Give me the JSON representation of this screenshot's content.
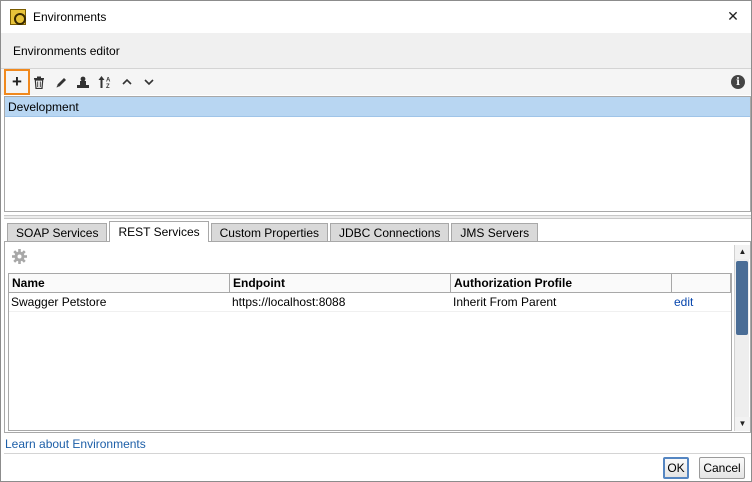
{
  "window": {
    "title": "Environments",
    "close_glyph": "✕"
  },
  "header": {
    "text": "Environments editor"
  },
  "toolbar": {
    "add_glyph": "+",
    "delete_glyph": "🗑",
    "edit_glyph": "✎",
    "clone_glyph": "⏏",
    "sort_glyph": "⇅",
    "up_glyph": "˄",
    "down_glyph": "˅",
    "info_glyph": "i",
    "accent_color": "#f0891e"
  },
  "environments": [
    "Development"
  ],
  "tabs": [
    "SOAP Services",
    "REST Services",
    "Custom Properties",
    "JDBC Connections",
    "JMS Servers"
  ],
  "active_tab": "REST Services",
  "table": {
    "columns": [
      "Name",
      "Endpoint",
      "Authorization Profile",
      ""
    ],
    "rows": [
      {
        "name": "Swagger Petstore",
        "endpoint": "https://localhost:8088",
        "auth": "Inherit From Parent",
        "action": "edit"
      }
    ]
  },
  "footer": {
    "learn_link": "Learn about Environments",
    "ok_label": "OK",
    "cancel_label": "Cancel"
  }
}
